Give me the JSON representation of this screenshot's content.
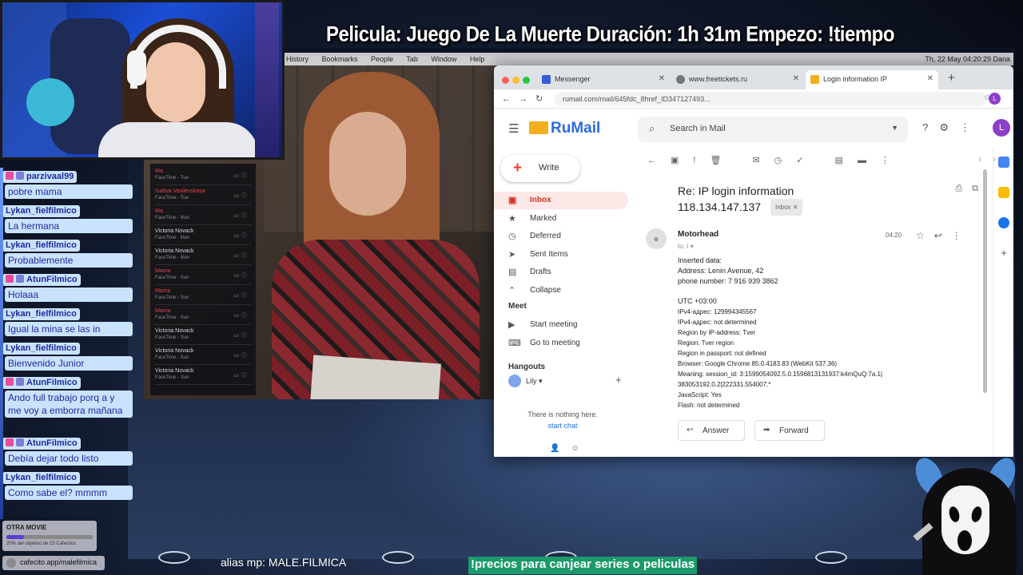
{
  "stream": {
    "title": "Pelicula: Juego De La Muerte Duración: 1h 31m Empezo: !tiempo",
    "alias": "alias mp: MALE.FILMICA",
    "prices_banner": "!precios para canjear series o peliculas",
    "goal": {
      "title": "OTRA MOVIE",
      "progress_text": "20% del objetivo de 15 Cafecitos",
      "progress": 0.2
    },
    "cafecito_link": "cafecito.app/malefilmica"
  },
  "chat": [
    {
      "user": "parzivaal99",
      "message": "pobre mama",
      "badge": true
    },
    {
      "user": "Lykan_fielfilmico",
      "message": "La hermana",
      "badge": false
    },
    {
      "user": "Lykan_fielfilmico",
      "message": "Probablemente",
      "badge": false
    },
    {
      "user": "AtunFilmico",
      "message": "Holaaa",
      "badge": true
    },
    {
      "user": "Lykan_fielfilmico",
      "message": "Igual la mina se las in",
      "badge": false
    },
    {
      "user": "Lykan_fielfilmico",
      "message": "Bienvenido Junior",
      "badge": false
    },
    {
      "user": "AtunFilmico",
      "message": "Ando full trabajo porq a y me voy a emborra mañana",
      "badge": true
    },
    {
      "user": "AtunFilmico",
      "message": "Debía dejar todo listo",
      "badge": true
    },
    {
      "user": "Lykan_fielfilmico",
      "message": "Como sabe el? mmmm",
      "badge": false
    }
  ],
  "mac_menubar": {
    "menus": "History Bookmarks People Tab Window Help",
    "clock": "Th, 22 May 04:20:29 Dana"
  },
  "facetime": [
    {
      "name": "Ma",
      "sub": "FaceTime - Tue",
      "missed": true
    },
    {
      "name": "Isabya Vasilevskaya",
      "sub": "FaceTime - Tue",
      "missed": true
    },
    {
      "name": "Ma",
      "sub": "FaceTime - Mon",
      "missed": true
    },
    {
      "name": "Victoria Novack",
      "sub": "FaceTime - Mon",
      "missed": false
    },
    {
      "name": "Victoria Novack",
      "sub": "FaceTime - Mon",
      "missed": false
    },
    {
      "name": "Mama",
      "sub": "FaceTime - Sun",
      "missed": true
    },
    {
      "name": "Mama",
      "sub": "FaceTime - Sun",
      "missed": true
    },
    {
      "name": "Mama",
      "sub": "FaceTime - Sun",
      "missed": true
    },
    {
      "name": "Victoria Novack",
      "sub": "FaceTime - Sun",
      "missed": false
    },
    {
      "name": "Victoria Novack",
      "sub": "FaceTime - Sun",
      "missed": false
    },
    {
      "name": "Victoria Novack",
      "sub": "FaceTime - Sun",
      "missed": false
    }
  ],
  "browser": {
    "tabs": [
      {
        "label": "Messenger",
        "color": "#3b5bdb"
      },
      {
        "label": "www.freetickets.ru",
        "color": "#777777"
      },
      {
        "label": "Login information IP",
        "color": "#f2b01e"
      }
    ],
    "url": "rumail.com/mail/645fdc_8href_ID347127493...",
    "profile_initial": "L"
  },
  "mail": {
    "brand": "RuMail",
    "search_placeholder": "Search in Mail",
    "write_label": "Write",
    "nav": [
      {
        "label": "Inbox",
        "icon": "inbox-icon",
        "glyph": "▣",
        "active": true
      },
      {
        "label": "Marked",
        "icon": "star-icon",
        "glyph": "★",
        "active": false
      },
      {
        "label": "Deferred",
        "icon": "clock-icon",
        "glyph": "◷",
        "active": false
      },
      {
        "label": "Sent Items",
        "icon": "send-icon",
        "glyph": "➤",
        "active": false
      },
      {
        "label": "Drafts",
        "icon": "draft-icon",
        "glyph": "▤",
        "active": false
      },
      {
        "label": "Collapse",
        "icon": "chevron-up-icon",
        "glyph": "⌃",
        "active": false
      }
    ],
    "meet": {
      "label": "Meet",
      "items": [
        "Start meeting",
        "Go to meeting"
      ]
    },
    "hangouts": {
      "label": "Hangouts",
      "user": "Lily",
      "empty_text": "There is nothing here.",
      "start_chat": "start chat"
    },
    "message": {
      "subject_line1": "Re: IP login information",
      "subject_line2": "118.134.147.137",
      "label_badge": "Inbox",
      "sender": "Motorhead",
      "to": "to: I",
      "time": "04:20",
      "body": [
        "Inserted data:",
        "Address: Lenin Avenue, 42",
        "phone number:  7 916 939 3862",
        "UTC +03:00",
        "IPv4-адрес:  129994345567",
        "IPv4-адрес: not determined",
        "Region by IP-address: Tver",
        "Region: Tver region",
        "Region in passport: not defined",
        "Browser:  Google Chrome 85.0.4183.83 (WebKit 537.36)",
        "Meaning:  session_id: 3:1599054092.5.0.1596813131937:k4mQuQ:7a.1|",
        "383053192.0.2|222331.554007.*",
        "JavaScript: Yes",
        "Flash: not determined"
      ],
      "reply_label": "Answer",
      "forward_label": "Forward"
    }
  }
}
